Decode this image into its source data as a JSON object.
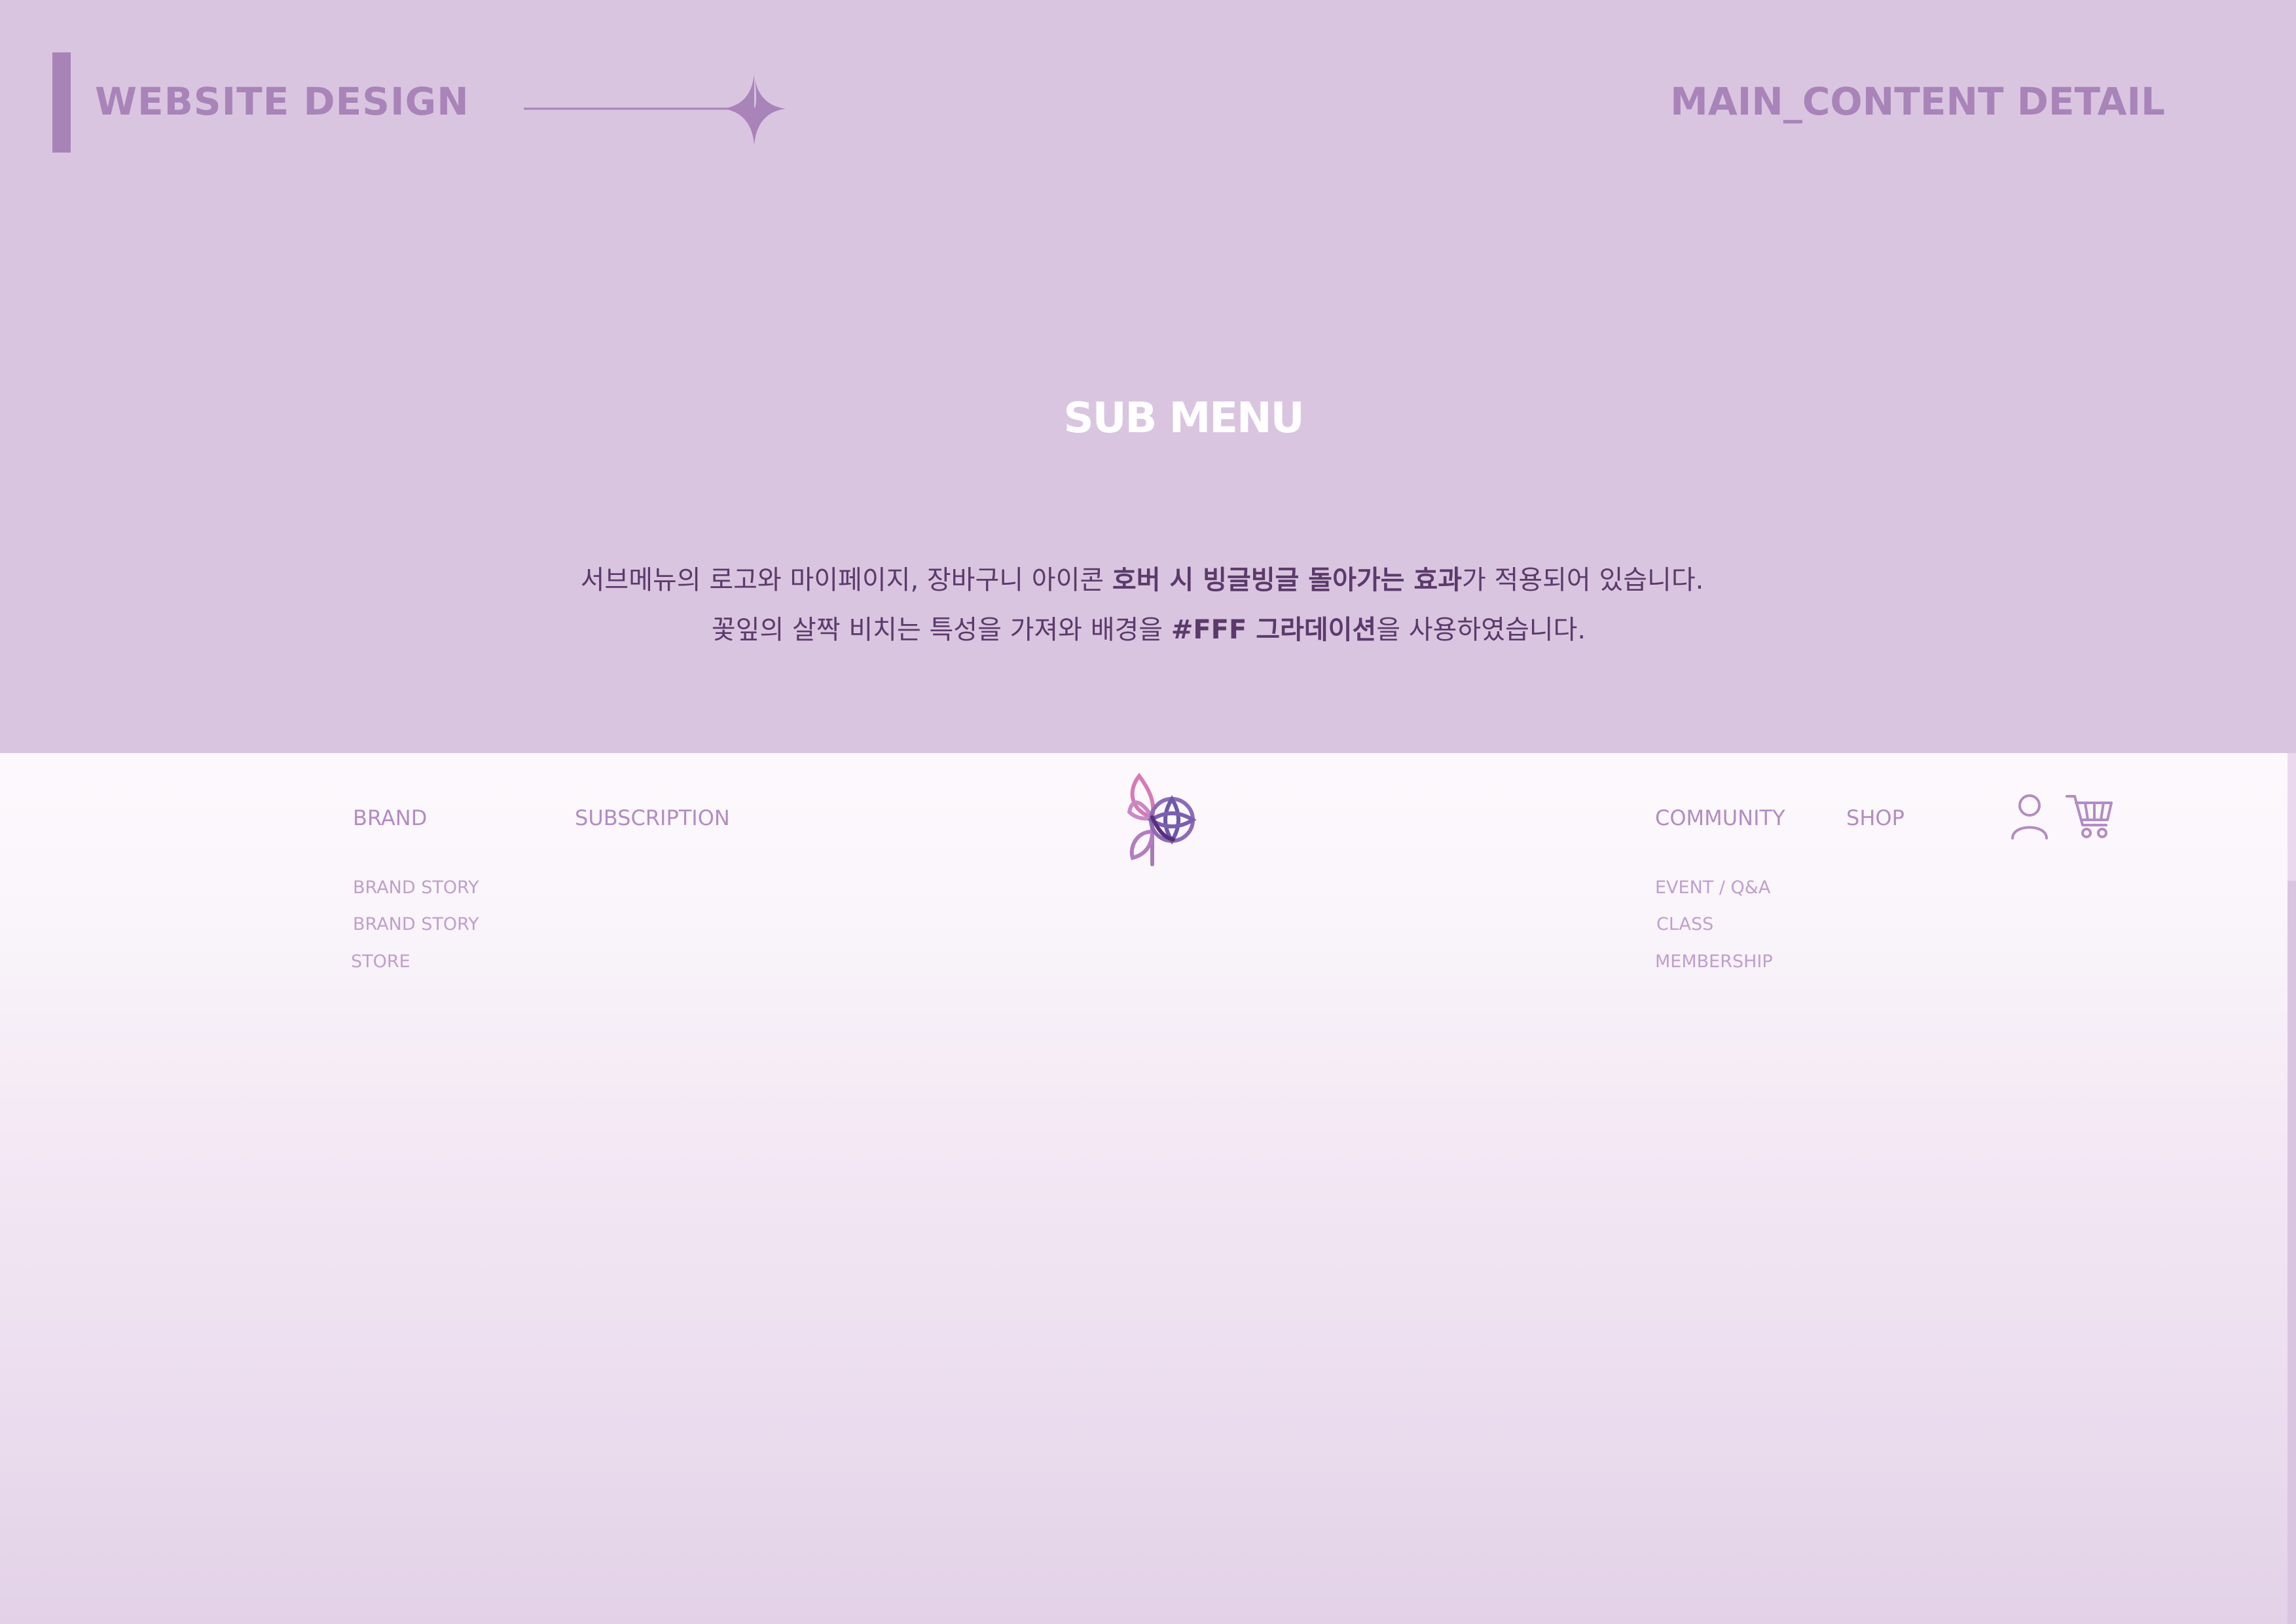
{
  "header": {
    "title": "WEBSITE DESIGN",
    "section": "MAIN_CONTENT DETAIL",
    "decoration_icon": "sparkle-icon"
  },
  "section_title": "SUB MENU",
  "description": {
    "line1_pre": "서브메뉴의 로고와 마이페이지, 장바구니 아이콘  ",
    "line1_bold": "호버 시 빙글빙글 돌아가는 효과",
    "line1_post": "가 적용되어 있습니다.",
    "line2_pre": "꽃잎의 살짝 비치는 특성을 가져와 배경을 ",
    "line2_bold": "#FFF 그라데이션",
    "line2_post": "을 사용하였습니다."
  },
  "menu": {
    "brand": {
      "label": "BRAND",
      "items": [
        "BRAND STORY",
        "BRAND STORY",
        "STORE"
      ]
    },
    "subscription": {
      "label": "SUBSCRIPTION"
    },
    "community": {
      "label": "COMMUNITY",
      "items": [
        "EVENT / Q&A",
        "CLASS",
        "MEMBERSHIP"
      ]
    },
    "shop": {
      "label": "SHOP"
    },
    "icons": {
      "logo": "flower-logo-icon",
      "mypage": "user-icon",
      "cart": "cart-icon"
    }
  },
  "colors": {
    "background": "#dac5e0",
    "accent": "#a884b9",
    "text_dark": "#5b3a6b",
    "menu_text": "#b38cc1",
    "submenu_text": "#c09fcb",
    "gradient_top": "#fcf9fd",
    "gradient_bottom": "#e3d2e7"
  }
}
